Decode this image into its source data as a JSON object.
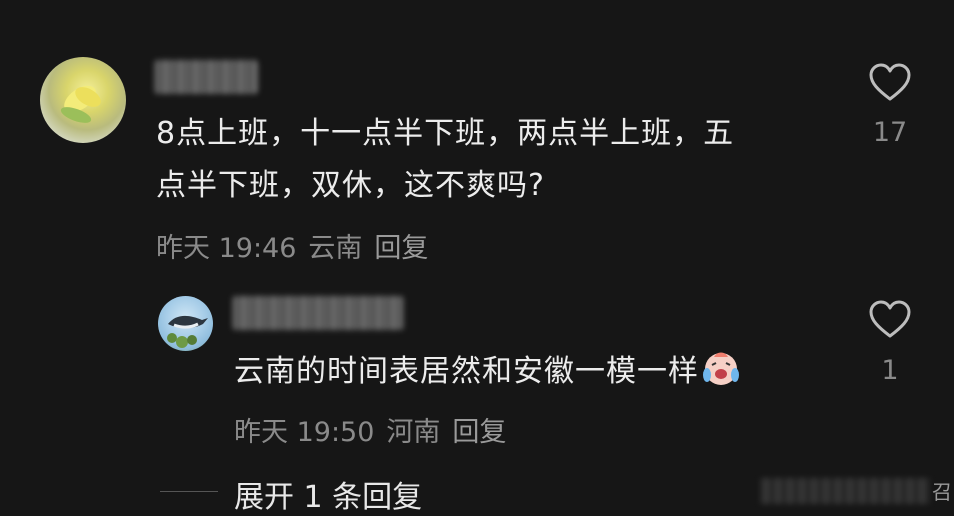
{
  "comments": [
    {
      "line1": "8点上班，十一点半下班，两点半上班，五",
      "line2": "点半下班，双休，这不爽吗?",
      "time": "昨天 19:46",
      "location": "云南",
      "reply_label": "回复",
      "likes": "17",
      "like_icon": "heart-outline-icon"
    },
    {
      "text": "云南的时间表居然和安徽一模一样",
      "emoji": "crying-laughing-emoji",
      "time": "昨天 19:50",
      "location": "河南",
      "reply_label": "回复",
      "likes": "1",
      "like_icon": "heart-outline-icon"
    }
  ],
  "expand_replies": "展开 1 条回复",
  "edge_text": "召"
}
